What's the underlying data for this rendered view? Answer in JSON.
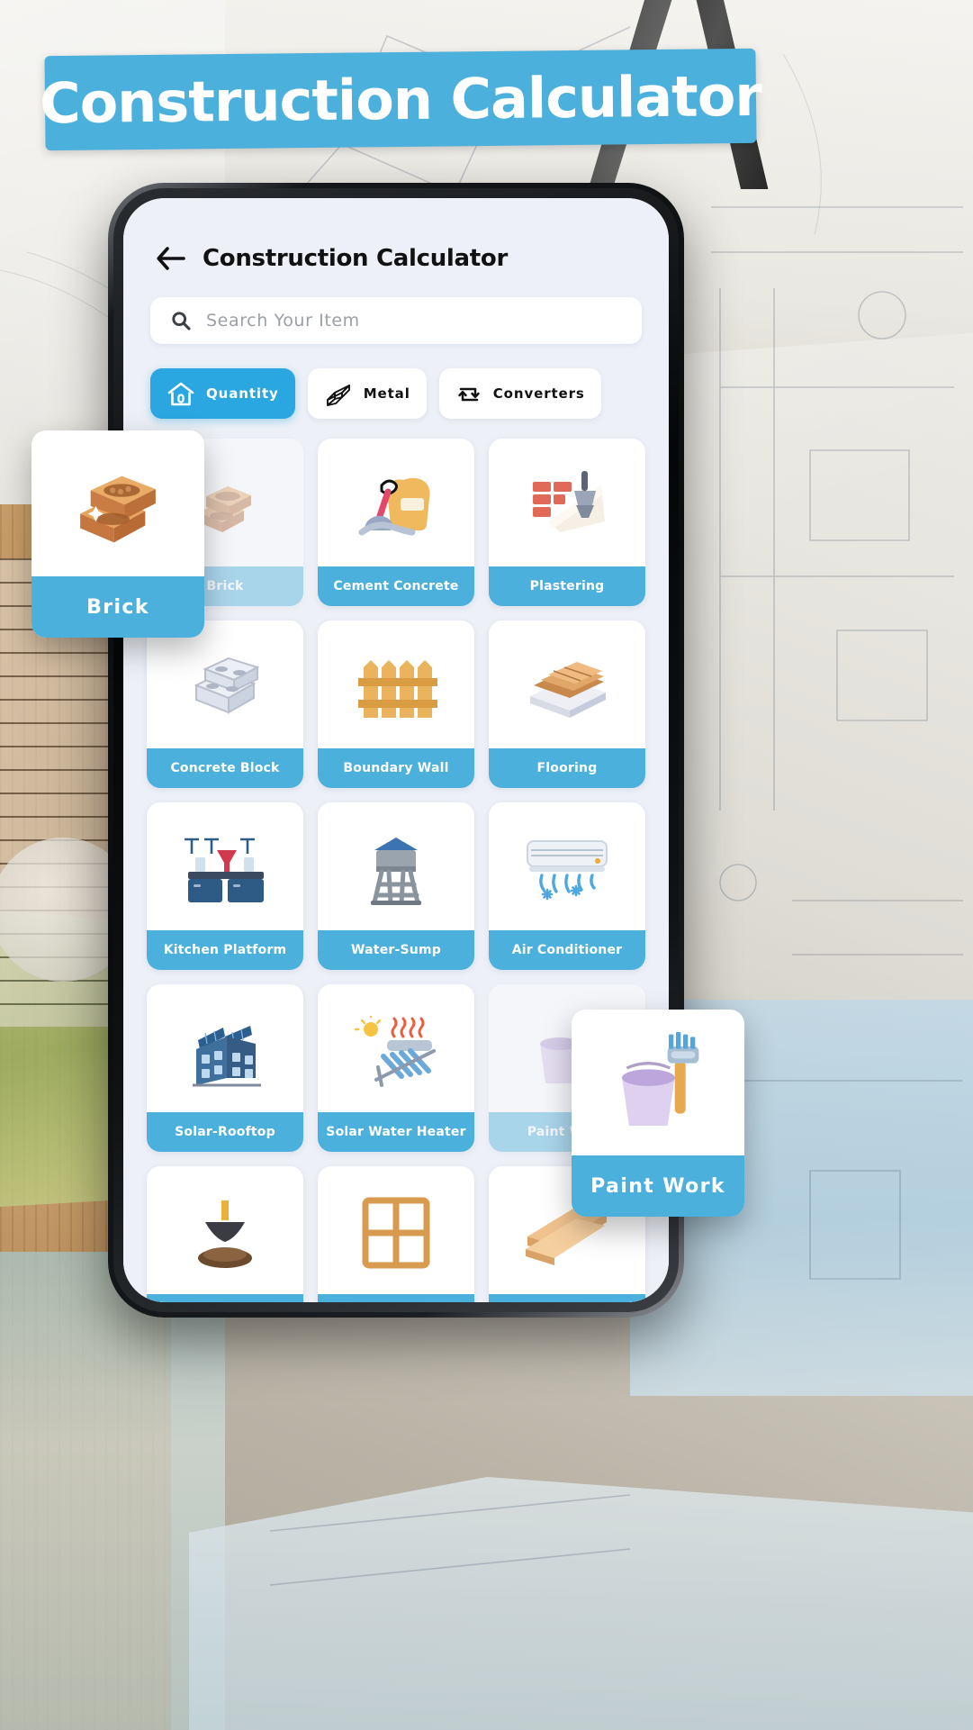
{
  "banner": {
    "title": "Construction Calculator"
  },
  "app": {
    "back_icon": "back-arrow-icon",
    "title": "Construction Calculator",
    "search": {
      "icon": "search-icon",
      "placeholder": "Search Your Item",
      "value": ""
    },
    "tabs": [
      {
        "label": "Quantity",
        "icon": "home-icon",
        "active": true
      },
      {
        "label": "Metal",
        "icon": "i-beam-icon",
        "active": false
      },
      {
        "label": "Converters",
        "icon": "convert-arrows-icon",
        "active": false
      }
    ],
    "grid": [
      {
        "label": "Brick",
        "icon": "brick-icon",
        "dim": true
      },
      {
        "label": "Cement Concrete",
        "icon": "cement-bag-icon",
        "dim": false
      },
      {
        "label": "Plastering",
        "icon": "plastering-trowel-icon",
        "dim": false
      },
      {
        "label": "Concrete Block",
        "icon": "concrete-block-icon",
        "dim": false
      },
      {
        "label": "Boundary Wall",
        "icon": "fence-icon",
        "dim": false
      },
      {
        "label": "Flooring",
        "icon": "flooring-tiles-icon",
        "dim": false
      },
      {
        "label": "Kitchen Platform",
        "icon": "kitchen-platform-icon",
        "dim": false
      },
      {
        "label": "Water-Sump",
        "icon": "water-tower-icon",
        "dim": false
      },
      {
        "label": "Air Conditioner",
        "icon": "air-conditioner-icon",
        "dim": false
      },
      {
        "label": "Solar-Rooftop",
        "icon": "solar-rooftop-icon",
        "dim": false
      },
      {
        "label": "Solar Water Heater",
        "icon": "solar-water-heater-icon",
        "dim": false
      },
      {
        "label": "Paint Work",
        "icon": "paint-bucket-icon",
        "dim": true
      },
      {
        "label": "",
        "icon": "excavation-icon",
        "dim": false
      },
      {
        "label": "",
        "icon": "window-icon",
        "dim": false
      },
      {
        "label": "",
        "icon": "wood-planks-icon",
        "dim": false
      }
    ]
  },
  "popups": [
    {
      "label": "Brick",
      "icon": "brick-icon"
    },
    {
      "label": "Paint Work",
      "icon": "paint-bucket-icon"
    }
  ],
  "colors": {
    "accent": "#4cb0dc",
    "accent_active": "#2aa6e0",
    "app_bg": "#edf0f7",
    "card_bg": "#ffffff",
    "text": "#111111",
    "placeholder": "#9b9fa6"
  }
}
